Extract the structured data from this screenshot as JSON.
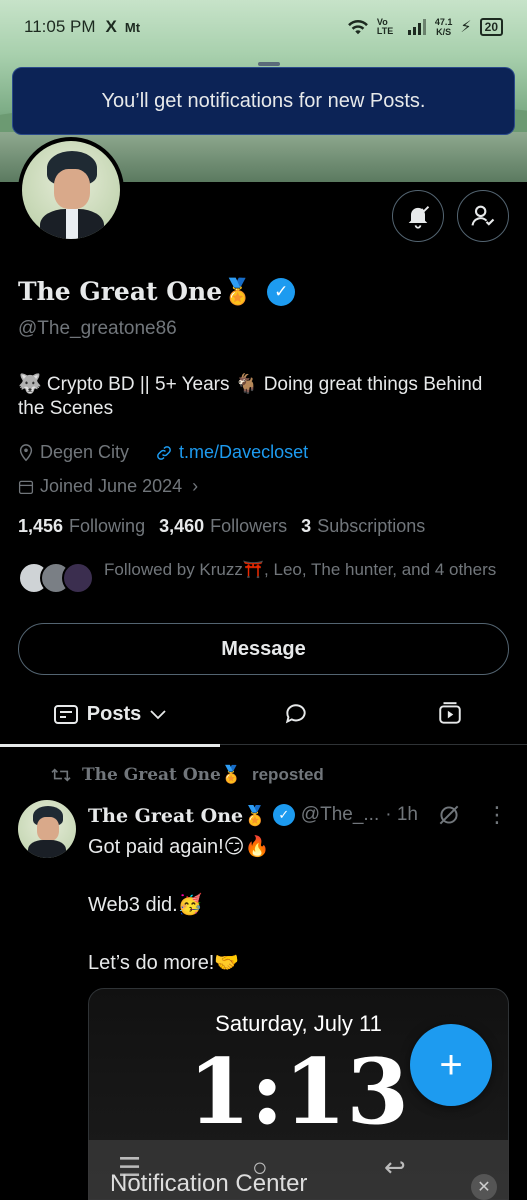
{
  "status_bar": {
    "time": "11:05 PM",
    "x_icon": "X",
    "mk": "Mt",
    "net_speed_value": "47.1",
    "net_speed_unit": "K/S",
    "signal_label": "Vo LTE",
    "battery": "20"
  },
  "toast": {
    "text": "You’ll get notifications for new Posts."
  },
  "profile": {
    "display_name": "The Great One🏅",
    "handle": "@The_greatone86",
    "bio": "🐺 Crypto BD || 5+ Years 🐐 Doing great things Behind the Scenes",
    "location": "Degen City",
    "link": "t.me/Davecloset",
    "joined": "Joined June 2024",
    "following_count": "1,456",
    "following_label": "Following",
    "followers_count": "3,460",
    "followers_label": "Followers",
    "subscriptions_count": "3",
    "subscriptions_label": "Subscriptions",
    "followed_by": "Followed by Kruzz⛩️, Leo, The hunter, and 4 others",
    "message_button": "Message"
  },
  "tabs": {
    "posts_label": "Posts"
  },
  "post": {
    "repost_name": "The Great One🏅",
    "repost_suffix": "reposted",
    "author_name": "The Great One🏅",
    "author_handle": "@The_...",
    "time": "· 1h",
    "text": "Got paid again!😏🔥\n\nWeb3 did.🥳\n\nLet’s do more!🤝",
    "media_date": "Saturday, July 11",
    "media_time": "1:13"
  },
  "fab": {
    "icon": "+"
  },
  "overlay_nav": {
    "label": "Notification Center"
  },
  "icons": {
    "accent": "#1d9bf0"
  }
}
